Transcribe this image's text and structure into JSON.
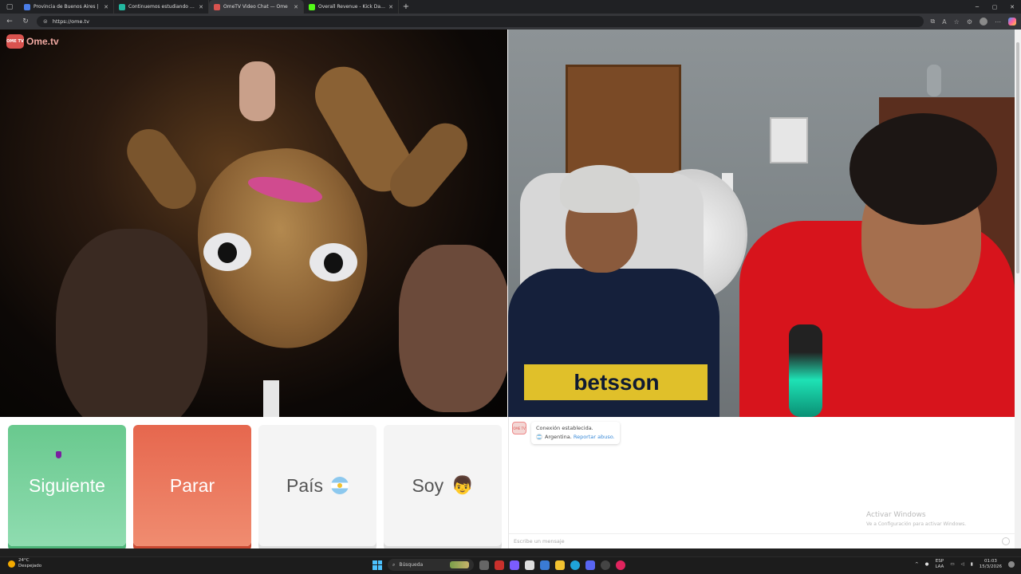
{
  "browser": {
    "tabs": [
      {
        "title": "Provincia de Buenos Aires |",
        "favicon_color": "#4a7de8",
        "active": false
      },
      {
        "title": "Continuemos estudiando – Plata",
        "favicon_color": "#22b8a0",
        "active": false
      },
      {
        "title": "OmeTV Video Chat — Ome",
        "favicon_color": "#d9534f",
        "active": true
      },
      {
        "title": "Overall Revenue - Kick Dashboard",
        "favicon_color": "#53fc18",
        "active": false
      }
    ],
    "url": "https://ome.tv"
  },
  "site": {
    "logo_text": "Ome.tv",
    "logo_mark": "OME TV"
  },
  "controls": {
    "next_label": "Siguiente",
    "stop_label": "Parar",
    "country_label": "País",
    "gender_label": "Soy",
    "gender_emoji": "👦",
    "colors": {
      "next": "#69c98e",
      "stop": "#e6674e",
      "neutral": "#f4f4f4"
    }
  },
  "chat": {
    "status_line": "Conexión establecida.",
    "country": "Argentina.",
    "report_link": "Reportar abuso.",
    "input_placeholder": "Escribe un mensaje",
    "watermark_title": "Activar Windows",
    "watermark_sub": "Ve a Configuración para activar Windows."
  },
  "taskbar": {
    "weather_temp": "24°C",
    "weather_desc": "Despejado",
    "search_label": "Búsqueda",
    "lang_top": "ESP",
    "lang_bottom": "LAA",
    "time": "01:03",
    "date": "15/3/2026"
  }
}
